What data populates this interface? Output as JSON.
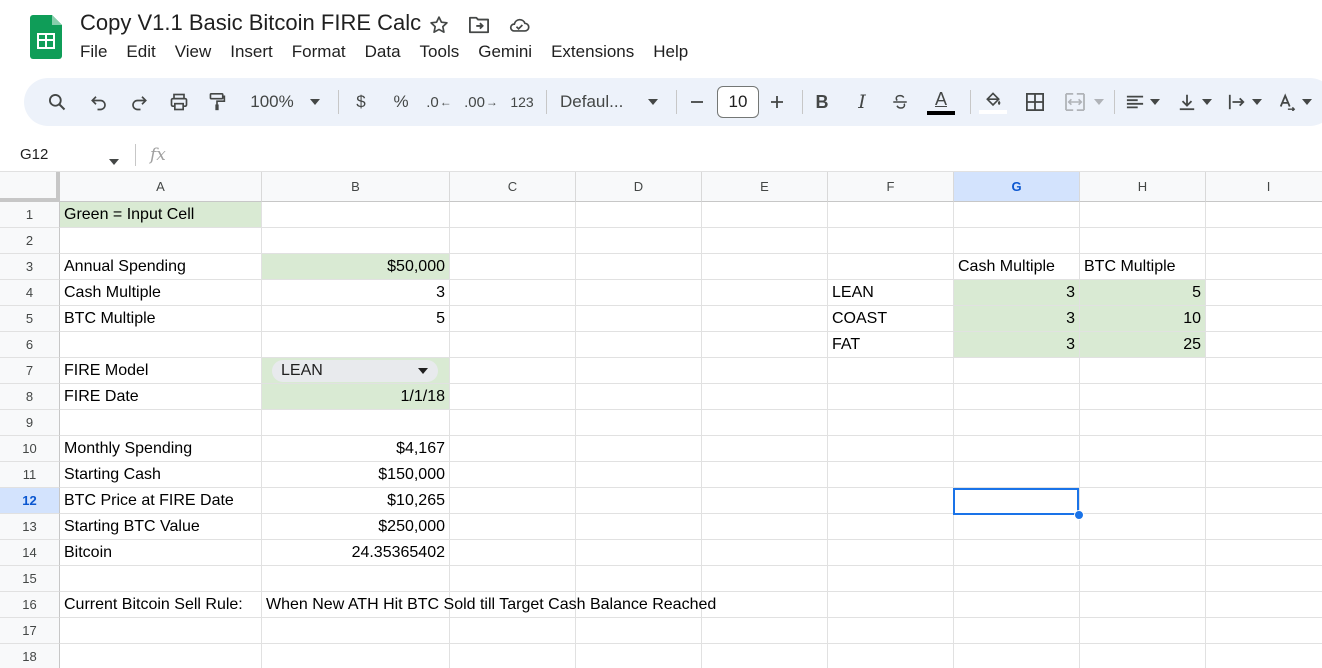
{
  "app": {
    "title": "Copy V1.1 Basic Bitcoin FIRE Calc",
    "menu": [
      "File",
      "Edit",
      "View",
      "Insert",
      "Format",
      "Data",
      "Tools",
      "Gemini",
      "Extensions",
      "Help"
    ]
  },
  "toolbar": {
    "zoom": "100%",
    "currency": "$",
    "percent": "%",
    "dec_decrease": ".0",
    "dec_increase": ".00",
    "number_format": "123",
    "font": "Defaul...",
    "font_size": "10",
    "bold": "B",
    "italic": "I",
    "text_color": "A"
  },
  "formula_bar": {
    "name_box": "G12",
    "fx": "fx"
  },
  "columns": [
    "A",
    "B",
    "C",
    "D",
    "E",
    "F",
    "G",
    "H",
    "I"
  ],
  "rows": [
    "1",
    "2",
    "3",
    "4",
    "5",
    "6",
    "7",
    "8",
    "9",
    "10",
    "11",
    "12",
    "13",
    "14",
    "15",
    "16",
    "17",
    "18"
  ],
  "cells": {
    "A1": "Green = Input Cell",
    "A3": "Annual Spending",
    "B3": "$50,000",
    "A4": "Cash Multiple",
    "B4": "3",
    "A5": "BTC Multiple",
    "B5": "5",
    "A7": "FIRE Model",
    "B7": "LEAN",
    "A8": "FIRE Date",
    "B8": "1/1/18",
    "A10": "Monthly Spending",
    "B10": "$4,167",
    "A11": "Starting Cash",
    "B11": "$150,000",
    "A12": "BTC Price at FIRE Date",
    "B12": "$10,265",
    "A13": "Starting BTC Value",
    "B13": "$250,000",
    "A14": "Bitcoin",
    "B14": "24.35365402",
    "A16": "Current Bitcoin Sell Rule:",
    "B16": "When New ATH Hit BTC Sold till Target Cash Balance Reached",
    "G3": "Cash Multiple",
    "H3": "BTC Multiple",
    "F4": "LEAN",
    "G4": "3",
    "H4": "5",
    "F5": "COAST",
    "G5": "3",
    "H5": "10",
    "F6": "FAT",
    "G6": "3",
    "H6": "25"
  },
  "colors": {
    "input_green": "#d9ead3",
    "selection_blue": "#1a73e8",
    "toolbar_bg": "#edf2fa",
    "sheets_green": "#0f9d58"
  }
}
